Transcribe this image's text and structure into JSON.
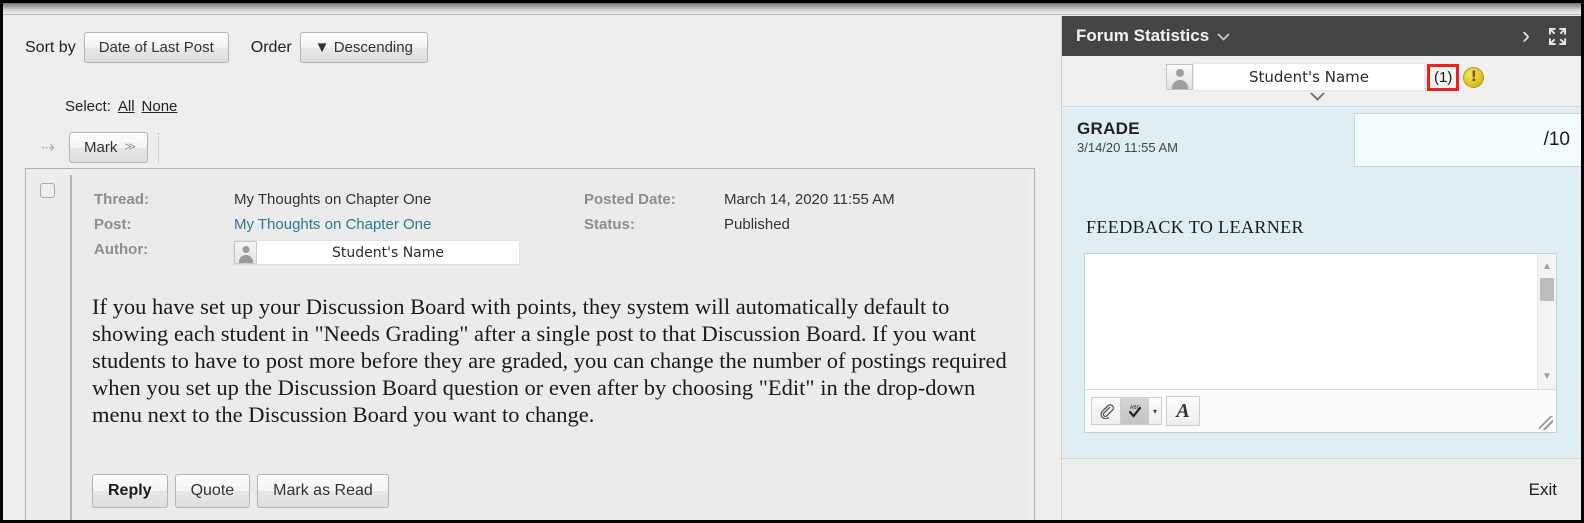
{
  "toolbar": {
    "sort_by_label": "Sort by",
    "sort_by_value": "Date of Last Post",
    "order_label": "Order",
    "order_value": "Descending",
    "order_caret": "▼",
    "select_label": "Select:",
    "select_all": "All",
    "select_none": "None",
    "mark_label": "Mark",
    "mark_caret": "≫",
    "flow_arrow": "⇢"
  },
  "post": {
    "labels": {
      "thread": "Thread:",
      "post": "Post:",
      "author": "Author:",
      "posted_date": "Posted Date:",
      "status": "Status:"
    },
    "thread_title": "My Thoughts on Chapter One",
    "post_title": "My Thoughts on Chapter One",
    "author_name": "Student's Name",
    "posted_date": "March 14, 2020 11:55 AM",
    "status": "Published",
    "body": "If you have set up your Discussion Board with points, they system will automatically default to showing each student in \"Needs Grading\" after a single post to that Discussion Board. If you want students to have to post more before they are graded, you can change the number of postings required when you set up the Discussion Board question or even after by choosing \"Edit\" in the drop-down menu next to the Discussion Board you want to change.",
    "actions": {
      "reply": "Reply",
      "quote": "Quote",
      "mark_as_read": "Mark as Read"
    }
  },
  "grading_panel": {
    "header_title": "Forum Statistics",
    "header_chevron": "⌵",
    "next_icon": "›",
    "expand_icon": "expand",
    "student_name": "Student's Name",
    "attempt_count": "(1)",
    "needs_grading_icon": "!",
    "student_chevron": "⌵",
    "grade_label": "GRADE",
    "grade_date": "3/14/20 11:55 AM",
    "grade_value": "",
    "grade_points": "/10",
    "feedback_label": "FEEDBACK TO LEARNER",
    "feedback_value": "",
    "editor_tools": {
      "attach": "📎",
      "spellcheck": "✔",
      "spellcheck_caret": "▾",
      "font": "A"
    },
    "exit_label": "Exit"
  },
  "colors": {
    "panel_header_bg": "#444444",
    "grade_block_bg": "#e0eef3",
    "highlight_outline": "#ee2020",
    "link": "#2a7a93"
  }
}
